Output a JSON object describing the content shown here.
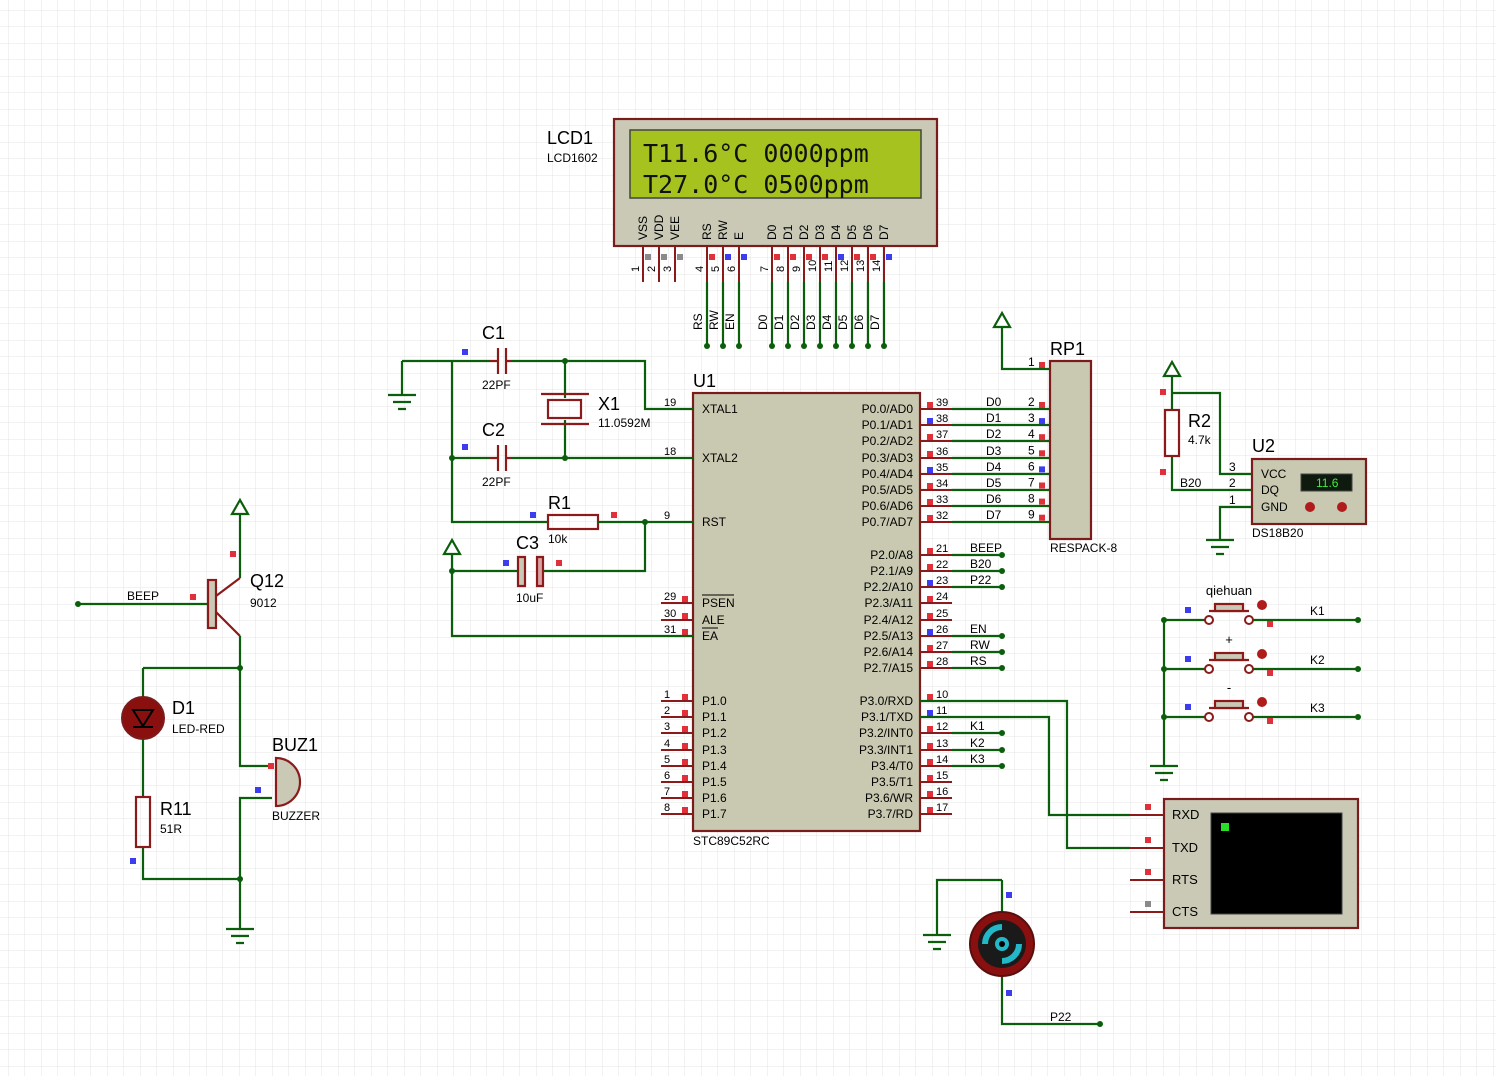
{
  "lcd": {
    "ref": "LCD1",
    "value": "LCD1602",
    "line1": "T11.6°C 0000ppm",
    "line2": "T27.0°C 0500ppm",
    "pins": [
      "VSS",
      "VDD",
      "VEE",
      "RS",
      "RW",
      "E",
      "D0",
      "D1",
      "D2",
      "D3",
      "D4",
      "D5",
      "D6",
      "D7"
    ],
    "pin_nums": [
      "1",
      "2",
      "3",
      "4",
      "5",
      "6",
      "7",
      "8",
      "9",
      "10",
      "11",
      "12",
      "13",
      "14"
    ],
    "nets": [
      "RS",
      "RW",
      "EN",
      "D0",
      "D1",
      "D2",
      "D3",
      "D4",
      "D5",
      "D6",
      "D7"
    ]
  },
  "mcu": {
    "ref": "U1",
    "value": "STC89C52RC",
    "left": [
      {
        "num": "19",
        "name": "XTAL1"
      },
      {
        "num": "18",
        "name": "XTAL2"
      },
      {
        "num": "9",
        "name": "RST"
      },
      {
        "num": "29",
        "name": "PSEN"
      },
      {
        "num": "30",
        "name": "ALE"
      },
      {
        "num": "31",
        "name": "EA"
      },
      {
        "num": "1",
        "name": "P1.0"
      },
      {
        "num": "2",
        "name": "P1.1"
      },
      {
        "num": "3",
        "name": "P1.2"
      },
      {
        "num": "4",
        "name": "P1.3"
      },
      {
        "num": "5",
        "name": "P1.4"
      },
      {
        "num": "6",
        "name": "P1.5"
      },
      {
        "num": "7",
        "name": "P1.6"
      },
      {
        "num": "8",
        "name": "P1.7"
      }
    ],
    "right": [
      {
        "num": "39",
        "name": "P0.0/AD0",
        "net": "D0"
      },
      {
        "num": "38",
        "name": "P0.1/AD1",
        "net": "D1"
      },
      {
        "num": "37",
        "name": "P0.2/AD2",
        "net": "D2"
      },
      {
        "num": "36",
        "name": "P0.3/AD3",
        "net": "D3"
      },
      {
        "num": "35",
        "name": "P0.4/AD4",
        "net": "D4"
      },
      {
        "num": "34",
        "name": "P0.5/AD5",
        "net": "D5"
      },
      {
        "num": "33",
        "name": "P0.6/AD6",
        "net": "D6"
      },
      {
        "num": "32",
        "name": "P0.7/AD7",
        "net": "D7"
      },
      {
        "num": "21",
        "name": "P2.0/A8",
        "net": "BEEP"
      },
      {
        "num": "22",
        "name": "P2.1/A9",
        "net": "B20"
      },
      {
        "num": "23",
        "name": "P2.2/A10",
        "net": "P22"
      },
      {
        "num": "24",
        "name": "P2.3/A11",
        "net": ""
      },
      {
        "num": "25",
        "name": "P2.4/A12",
        "net": ""
      },
      {
        "num": "26",
        "name": "P2.5/A13",
        "net": "EN"
      },
      {
        "num": "27",
        "name": "P2.6/A14",
        "net": "RW"
      },
      {
        "num": "28",
        "name": "P2.7/A15",
        "net": "RS"
      },
      {
        "num": "10",
        "name": "P3.0/RXD",
        "net": ""
      },
      {
        "num": "11",
        "name": "P3.1/TXD",
        "net": ""
      },
      {
        "num": "12",
        "name": "P3.2/INT0",
        "net": "K1"
      },
      {
        "num": "13",
        "name": "P3.3/INT1",
        "net": "K2"
      },
      {
        "num": "14",
        "name": "P3.4/T0",
        "net": "K3"
      },
      {
        "num": "15",
        "name": "P3.5/T1",
        "net": ""
      },
      {
        "num": "16",
        "name": "P3.6/WR",
        "net": ""
      },
      {
        "num": "17",
        "name": "P3.7/RD",
        "net": ""
      }
    ]
  },
  "rp1": {
    "ref": "RP1",
    "value": "RESPACK-8",
    "pins": [
      "1",
      "2",
      "3",
      "4",
      "5",
      "6",
      "7",
      "8",
      "9"
    ]
  },
  "c1": {
    "ref": "C1",
    "value": "22PF"
  },
  "c2": {
    "ref": "C2",
    "value": "22PF"
  },
  "x1": {
    "ref": "X1",
    "value": "11.0592M"
  },
  "r1": {
    "ref": "R1",
    "value": "10k"
  },
  "c3": {
    "ref": "C3",
    "value": "10uF"
  },
  "r2": {
    "ref": "R2",
    "value": "4.7k"
  },
  "u2": {
    "ref": "U2",
    "value": "DS18B20",
    "reading": "11.6",
    "pins": [
      {
        "num": "3",
        "name": "VCC"
      },
      {
        "num": "2",
        "name": "DQ"
      },
      {
        "num": "1",
        "name": "GND"
      }
    ],
    "net": "B20"
  },
  "buttons": [
    {
      "label": "qiehuan",
      "net": "K1"
    },
    {
      "label": "+",
      "net": "K2"
    },
    {
      "label": "-",
      "net": "K3"
    }
  ],
  "q12": {
    "ref": "Q12",
    "value": "9012",
    "net": "BEEP"
  },
  "d1": {
    "ref": "D1",
    "value": "LED-RED"
  },
  "r11": {
    "ref": "R11",
    "value": "51R"
  },
  "buz1": {
    "ref": "BUZ1",
    "value": "BUZZER"
  },
  "terminal": {
    "pins": [
      "RXD",
      "TXD",
      "RTS",
      "CTS"
    ]
  },
  "motor": {
    "net": "P22"
  }
}
